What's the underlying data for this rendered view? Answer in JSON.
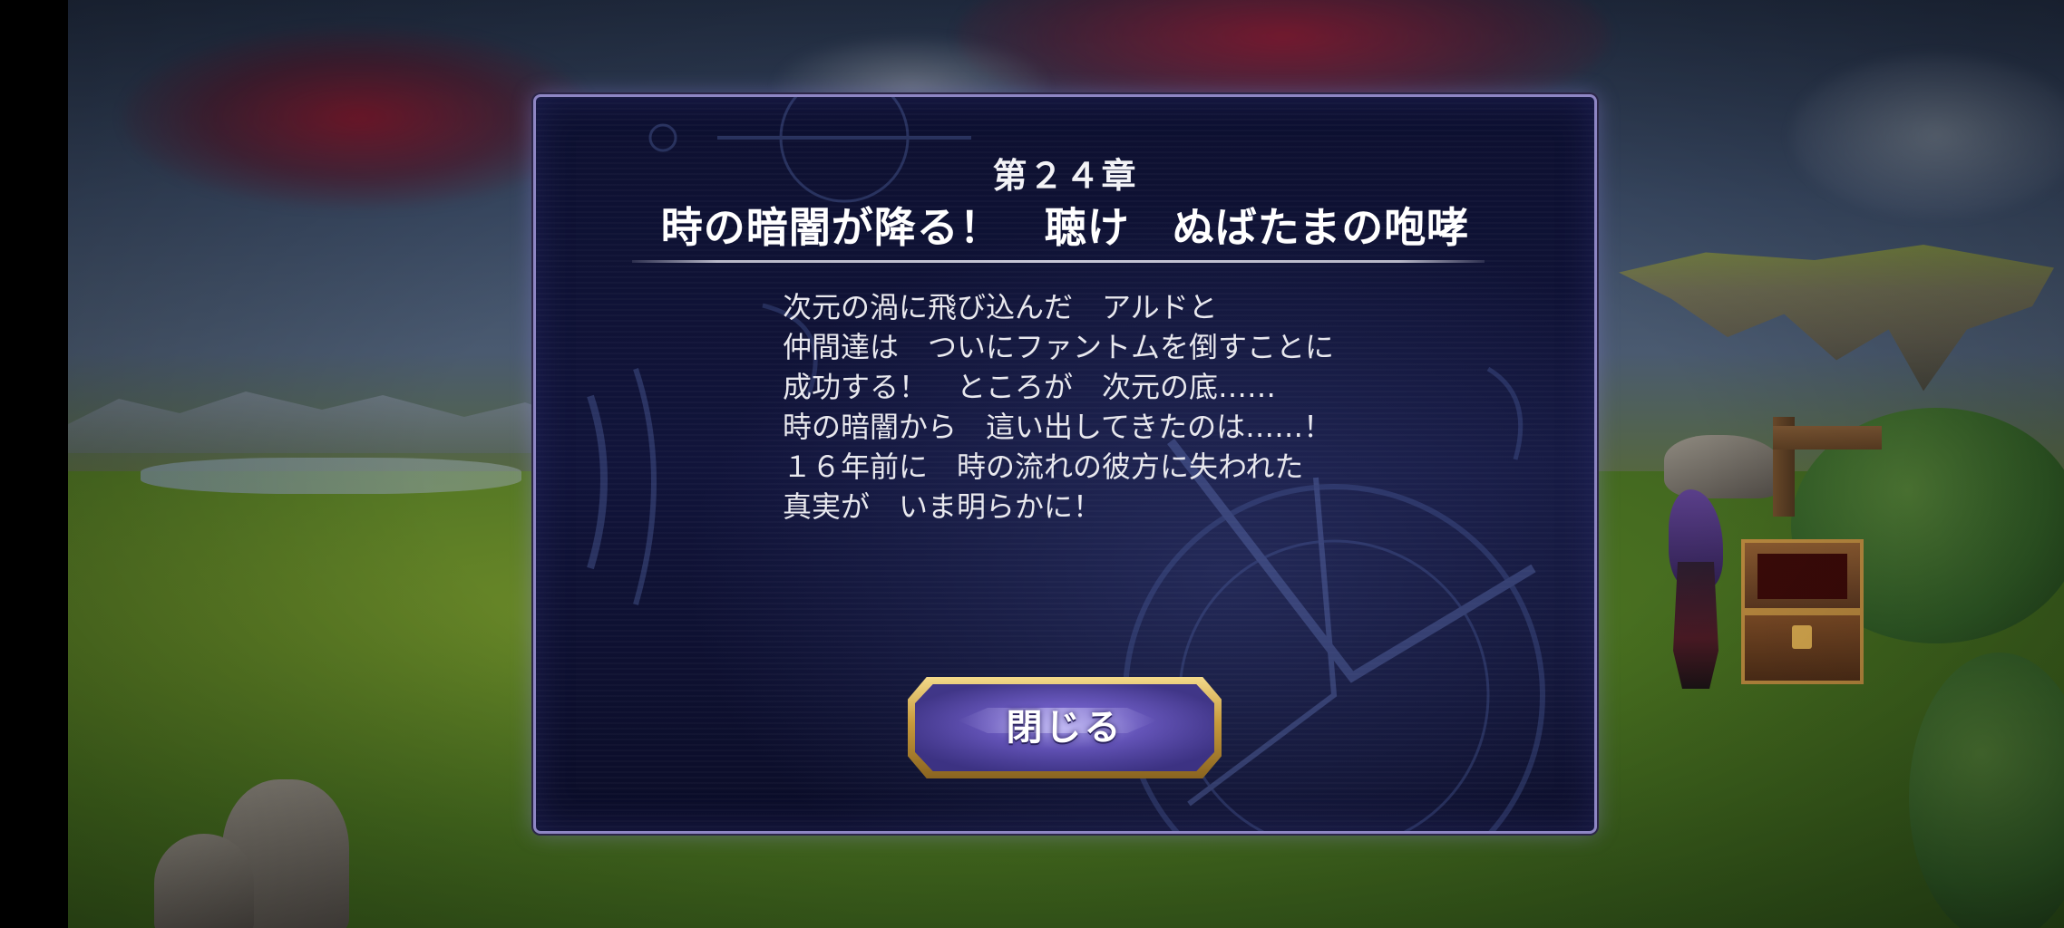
{
  "dialog": {
    "chapter": "第２４章",
    "title": "時の暗闇が降る！　聴け　ぬばたまの咆哮",
    "story_lines": [
      "次元の渦に飛び込んだ　アルドと",
      "仲間達は　ついにファントムを倒すことに",
      "成功する！　ところが　次元の底……",
      "時の暗闇から　這い出してきたのは……！",
      "１６年前に　時の流れの彼方に失われた",
      "真実が　いま明らかに！"
    ],
    "close_label": "閉じる"
  },
  "colors": {
    "dialog_border": "#8e86c4",
    "dialog_background": "#0d1030",
    "button_gold": "#c79a3c",
    "button_purple": "#6c5cc0"
  },
  "icons": {
    "chest": "treasure-chest-icon",
    "signpost": "signpost-icon"
  }
}
